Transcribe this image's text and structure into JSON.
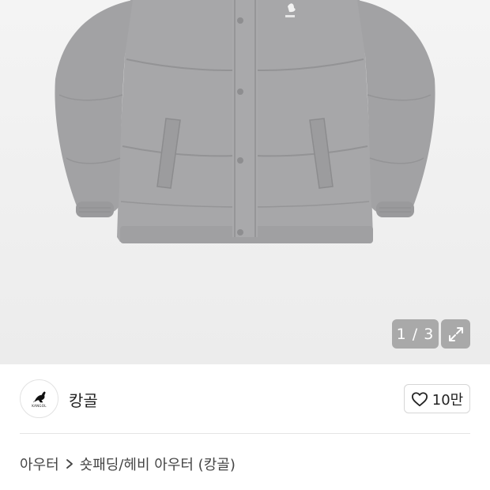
{
  "gallery": {
    "product_image": "gray-puffer-jacket",
    "counter_text": "1 / 3",
    "expand_icon": "expand-icon"
  },
  "brand": {
    "logo_icon": "kangaroo-logo-icon",
    "logo_text": "KANGOL",
    "name": "캉골"
  },
  "like": {
    "icon": "heart-outline-icon",
    "count": "10만"
  },
  "breadcrumb": {
    "items": [
      "아우터",
      "숏패딩/헤비 아우터 (캉골)"
    ],
    "separator_icon": "chevron-right-icon"
  },
  "colors": {
    "jacket": "#a4a4a6",
    "hero_bg": "#f0f0f0",
    "badge_bg": "#969696"
  }
}
